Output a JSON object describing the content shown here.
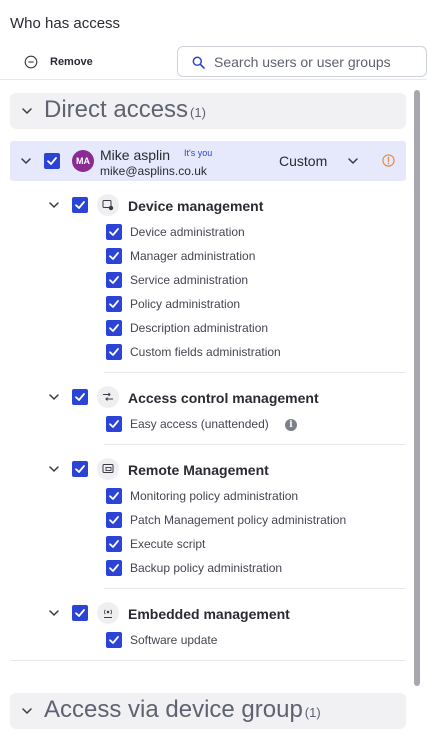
{
  "page_title": "Who has access",
  "toolbar": {
    "remove_label": "Remove",
    "search_placeholder": "Search users or user groups",
    "search_value": ""
  },
  "direct_access": {
    "title": "Direct access",
    "count": "(1)",
    "expanded": true
  },
  "user": {
    "initials": "MA",
    "name": "Mike asplin",
    "badge": "It's you",
    "email": "mike@asplins.co.uk",
    "role": "Custom",
    "checked": true
  },
  "groups": [
    {
      "title": "Device management",
      "icon": "device-management-icon",
      "checked": true,
      "permissions": [
        {
          "label": "Device administration",
          "checked": true
        },
        {
          "label": "Manager administration",
          "checked": true
        },
        {
          "label": "Service administration",
          "checked": true
        },
        {
          "label": "Policy administration",
          "checked": true
        },
        {
          "label": "Description administration",
          "checked": true
        },
        {
          "label": "Custom fields administration",
          "checked": true
        }
      ]
    },
    {
      "title": "Access control management",
      "icon": "access-control-icon",
      "checked": true,
      "permissions": [
        {
          "label": "Easy access (unattended)",
          "checked": true,
          "has_info": true
        }
      ]
    },
    {
      "title": "Remote Management",
      "icon": "remote-management-icon",
      "checked": true,
      "permissions": [
        {
          "label": "Monitoring policy administration",
          "checked": true
        },
        {
          "label": "Patch Management policy administration",
          "checked": true
        },
        {
          "label": "Execute script",
          "checked": true
        },
        {
          "label": "Backup policy administration",
          "checked": true
        }
      ]
    },
    {
      "title": "Embedded management",
      "icon": "embedded-management-icon",
      "checked": true,
      "permissions": [
        {
          "label": "Software update",
          "checked": true
        }
      ]
    }
  ],
  "device_group_access": {
    "title": "Access via device group",
    "count": "(1)",
    "expanded": false
  },
  "colors": {
    "accent": "#2b44d6",
    "avatar": "#8a2a93",
    "warning": "#e8853a",
    "user_row_bg": "#e6e9fb"
  }
}
